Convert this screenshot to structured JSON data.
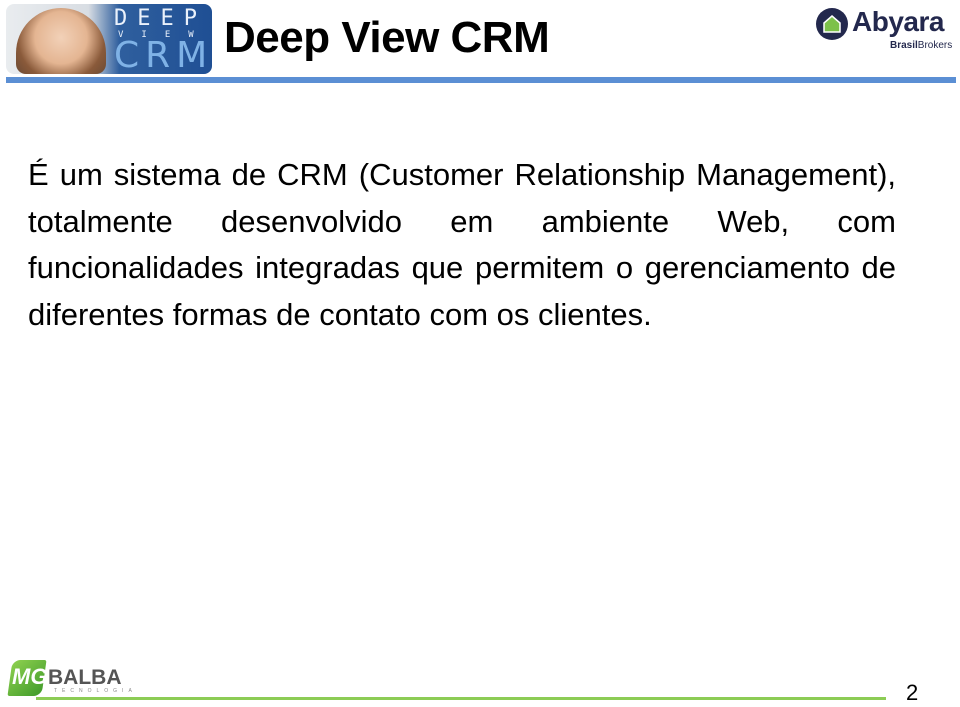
{
  "header": {
    "logo": {
      "line1": "DEEP",
      "line2": "VIEW",
      "line3": "CRM"
    },
    "title": "Deep View CRM",
    "partner_logo": {
      "name": "Abyara",
      "sub_bold": "Brasil",
      "sub_regular": "Brokers"
    }
  },
  "body": {
    "paragraph": "É um sistema de CRM (Customer Relationship Management), totalmente desenvolvido em ambiente Web, com funcionalidades integradas que permitem o gerenciamento de diferentes formas de contato com os clientes."
  },
  "footer": {
    "logo": {
      "mark": "MG",
      "name": "BALBA",
      "tagline": "TECNOLOGIA"
    },
    "page_number": "2"
  },
  "colors": {
    "top_rule": "#5b8fd4",
    "bottom_rule": "#8ccc55",
    "abyara_navy": "#23284d",
    "abyara_green": "#7dc14a"
  }
}
